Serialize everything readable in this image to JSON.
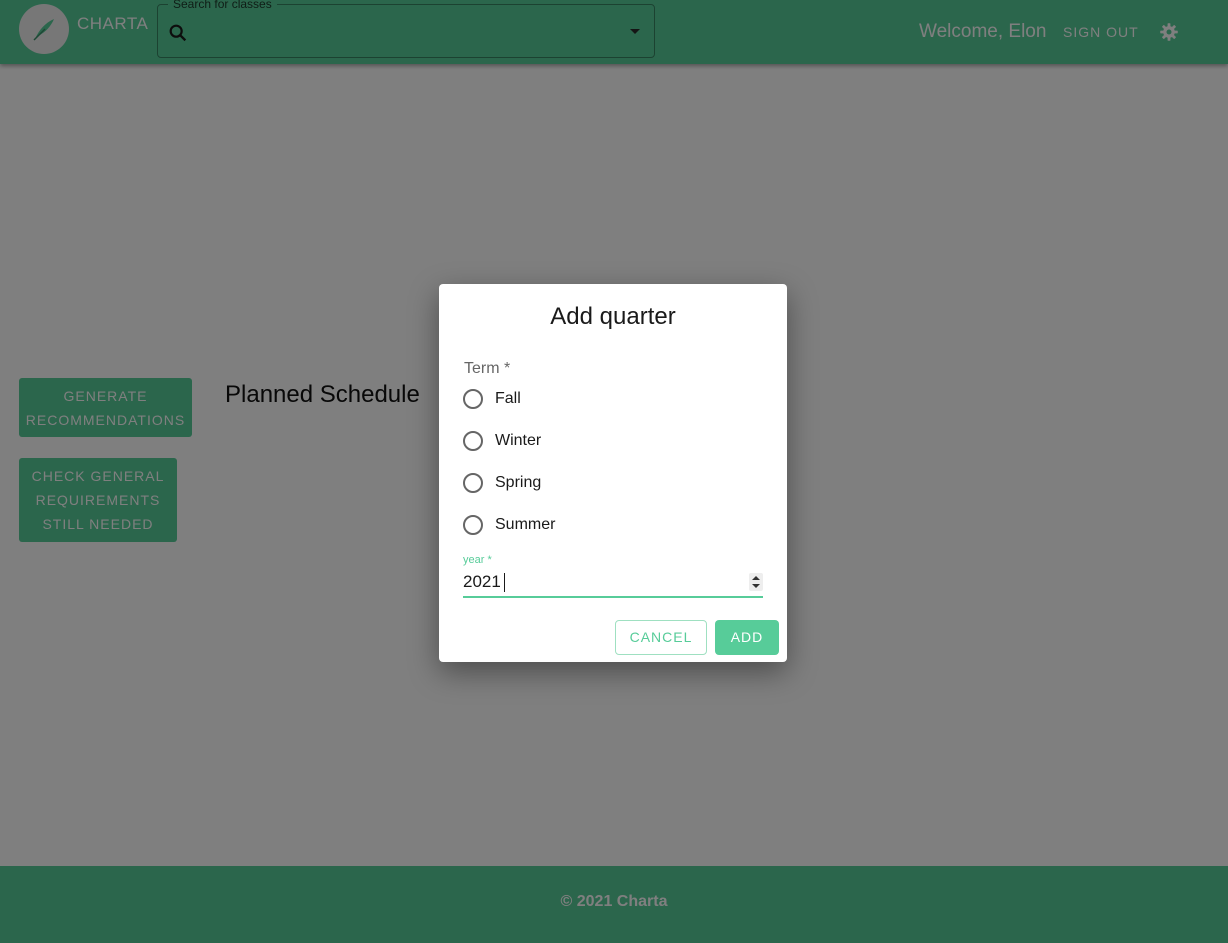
{
  "header": {
    "brand": "CHARTA",
    "search_legend": "Search for classes",
    "search_value": "",
    "welcome": "Welcome, Elon",
    "sign_out": "SIGN OUT"
  },
  "sidebar": {
    "generate_recommendations": "GENERATE RECOMMENDATIONS",
    "check_general_requirements": "CHECK GENERAL REQUIREMENTS STILL NEEDED"
  },
  "main": {
    "planned_schedule_title": "Planned Schedule"
  },
  "dialog": {
    "title": "Add quarter",
    "term_label": "Term *",
    "terms": [
      {
        "label": "Fall",
        "selected": false
      },
      {
        "label": "Winter",
        "selected": false
      },
      {
        "label": "Spring",
        "selected": false
      },
      {
        "label": "Summer",
        "selected": false
      }
    ],
    "year_label": "year *",
    "year_value": "2021",
    "cancel_label": "CANCEL",
    "add_label": "ADD"
  },
  "footer": {
    "text": "© 2021 Charta"
  },
  "colors": {
    "accent": "#57cc99",
    "accent_light": "#9fe0c1",
    "backdrop": "rgba(0,0,0,0.5)"
  },
  "icons": {
    "logo": "feather-logo",
    "search": "search-icon",
    "dropdown": "chevron-down-icon",
    "settings": "gear-icon"
  }
}
